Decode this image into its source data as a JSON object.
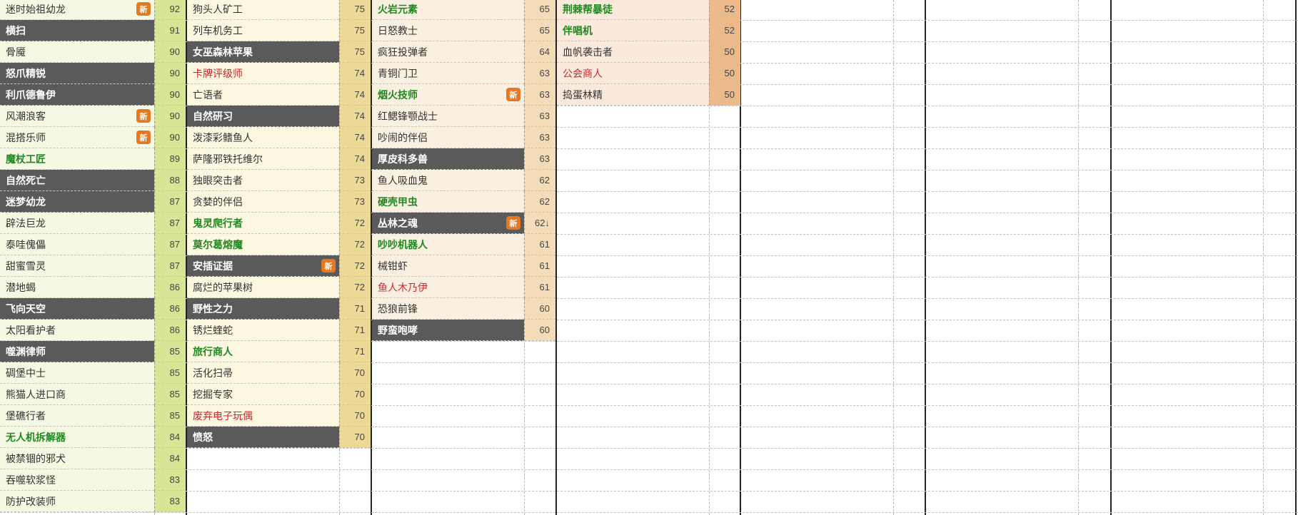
{
  "badge_label": "新",
  "colors": {
    "dark_row": "#5a5a5a",
    "green_text": "#1f8a1f",
    "red_text": "#d0252b",
    "badge": "#e67822",
    "col1_name_bg": "#f5f8e2",
    "col1_score_bg": "#d7e694",
    "col2_name_bg": "#fbf7e0",
    "col2_score_bg": "#ecd996",
    "col3_name_bg": "#faf0e2",
    "col3_score_bg": "#f4dcb8",
    "col4_name_bg": "#fbe9dc",
    "col4_score_bg": "#ebb98a"
  },
  "columns": [
    {
      "rows": [
        {
          "name": "迷时始祖幼龙",
          "score": "92",
          "style": "normal",
          "badge": true
        },
        {
          "name": "横扫",
          "score": "91",
          "style": "dark"
        },
        {
          "name": "骨魇",
          "score": "90",
          "style": "normal"
        },
        {
          "name": "怒爪精锐",
          "score": "90",
          "style": "dark"
        },
        {
          "name": "利爪德鲁伊",
          "score": "90",
          "style": "dark"
        },
        {
          "name": "风潮浪客",
          "score": "90",
          "style": "normal",
          "badge": true
        },
        {
          "name": "混搭乐师",
          "score": "90",
          "style": "normal",
          "badge": true
        },
        {
          "name": "魔杖工匠",
          "score": "89",
          "style": "green"
        },
        {
          "name": "自然死亡",
          "score": "88",
          "style": "dark"
        },
        {
          "name": "迷梦幼龙",
          "score": "87",
          "style": "dark"
        },
        {
          "name": "辟法巨龙",
          "score": "87",
          "style": "normal"
        },
        {
          "name": "泰哇傀儡",
          "score": "87",
          "style": "normal"
        },
        {
          "name": "甜蜜雪灵",
          "score": "87",
          "style": "normal"
        },
        {
          "name": "潜地蝎",
          "score": "86",
          "style": "normal"
        },
        {
          "name": "飞向天空",
          "score": "86",
          "style": "dark"
        },
        {
          "name": "太阳看护者",
          "score": "86",
          "style": "normal"
        },
        {
          "name": "噬渊律师",
          "score": "85",
          "style": "dark"
        },
        {
          "name": "碉堡中士",
          "score": "85",
          "style": "normal"
        },
        {
          "name": "熊猫人进口商",
          "score": "85",
          "style": "normal"
        },
        {
          "name": "堡礁行者",
          "score": "85",
          "style": "normal"
        },
        {
          "name": "无人机拆解器",
          "score": "84",
          "style": "green"
        },
        {
          "name": "被禁锢的邪犬",
          "score": "84",
          "style": "normal"
        },
        {
          "name": "吞噬软浆怪",
          "score": "83",
          "style": "normal"
        },
        {
          "name": "防护改装师",
          "score": "83",
          "style": "normal"
        }
      ]
    },
    {
      "rows": [
        {
          "name": "狗头人矿工",
          "score": "75",
          "style": "normal"
        },
        {
          "name": "列车机务工",
          "score": "75",
          "style": "normal"
        },
        {
          "name": "女巫森林苹果",
          "score": "75",
          "style": "dark"
        },
        {
          "name": "卡牌评级师",
          "score": "74",
          "style": "red"
        },
        {
          "name": "亡语者",
          "score": "74",
          "style": "normal"
        },
        {
          "name": "自然研习",
          "score": "74",
          "style": "dark"
        },
        {
          "name": "泼漆彩鳍鱼人",
          "score": "74",
          "style": "normal"
        },
        {
          "name": "萨隆邪铁托维尔",
          "score": "74",
          "style": "normal"
        },
        {
          "name": "独眼突击者",
          "score": "73",
          "style": "normal"
        },
        {
          "name": "贪婪的伴侣",
          "score": "73",
          "style": "normal"
        },
        {
          "name": "鬼灵爬行者",
          "score": "72",
          "style": "green"
        },
        {
          "name": "莫尔葛熔魔",
          "score": "72",
          "style": "green"
        },
        {
          "name": "安插证据",
          "score": "72",
          "style": "dark",
          "badge": true
        },
        {
          "name": "腐烂的苹果树",
          "score": "72",
          "style": "normal"
        },
        {
          "name": "野性之力",
          "score": "71",
          "style": "dark"
        },
        {
          "name": "锈烂蝰蛇",
          "score": "71",
          "style": "normal"
        },
        {
          "name": "旅行商人",
          "score": "71",
          "style": "green"
        },
        {
          "name": "活化扫帚",
          "score": "70",
          "style": "normal"
        },
        {
          "name": "挖掘专家",
          "score": "70",
          "style": "normal"
        },
        {
          "name": "废弃电子玩偶",
          "score": "70",
          "style": "red"
        },
        {
          "name": "愤怒",
          "score": "70",
          "style": "dark"
        }
      ]
    },
    {
      "rows": [
        {
          "name": "火岩元素",
          "score": "65",
          "style": "green"
        },
        {
          "name": "日怒教士",
          "score": "65",
          "style": "normal"
        },
        {
          "name": "疯狂投弹者",
          "score": "64",
          "style": "normal"
        },
        {
          "name": "青铜门卫",
          "score": "63",
          "style": "normal"
        },
        {
          "name": "烟火技师",
          "score": "63",
          "style": "green",
          "badge": true
        },
        {
          "name": "红鳃锋颚战士",
          "score": "63",
          "style": "normal"
        },
        {
          "name": "吵闹的伴侣",
          "score": "63",
          "style": "normal"
        },
        {
          "name": "厚皮科多兽",
          "score": "63",
          "style": "dark"
        },
        {
          "name": "鱼人吸血鬼",
          "score": "62",
          "style": "normal"
        },
        {
          "name": "硬壳甲虫",
          "score": "62",
          "style": "green"
        },
        {
          "name": "丛林之魂",
          "score": "62↓",
          "style": "dark",
          "badge": true
        },
        {
          "name": "吵吵机器人",
          "score": "61",
          "style": "green"
        },
        {
          "name": "械钳虾",
          "score": "61",
          "style": "normal"
        },
        {
          "name": "鱼人木乃伊",
          "score": "61",
          "style": "red"
        },
        {
          "name": "恐狼前锋",
          "score": "60",
          "style": "normal"
        },
        {
          "name": "野蛮咆哮",
          "score": "60",
          "style": "dark"
        }
      ]
    },
    {
      "rows": [
        {
          "name": "荆棘帮暴徒",
          "score": "52",
          "style": "green"
        },
        {
          "name": "伴唱机",
          "score": "52",
          "style": "green"
        },
        {
          "name": "血帆袭击者",
          "score": "50",
          "style": "normal"
        },
        {
          "name": "公会商人",
          "score": "50",
          "style": "red"
        },
        {
          "name": "捣蛋林精",
          "score": "50",
          "style": "normal"
        }
      ]
    }
  ]
}
